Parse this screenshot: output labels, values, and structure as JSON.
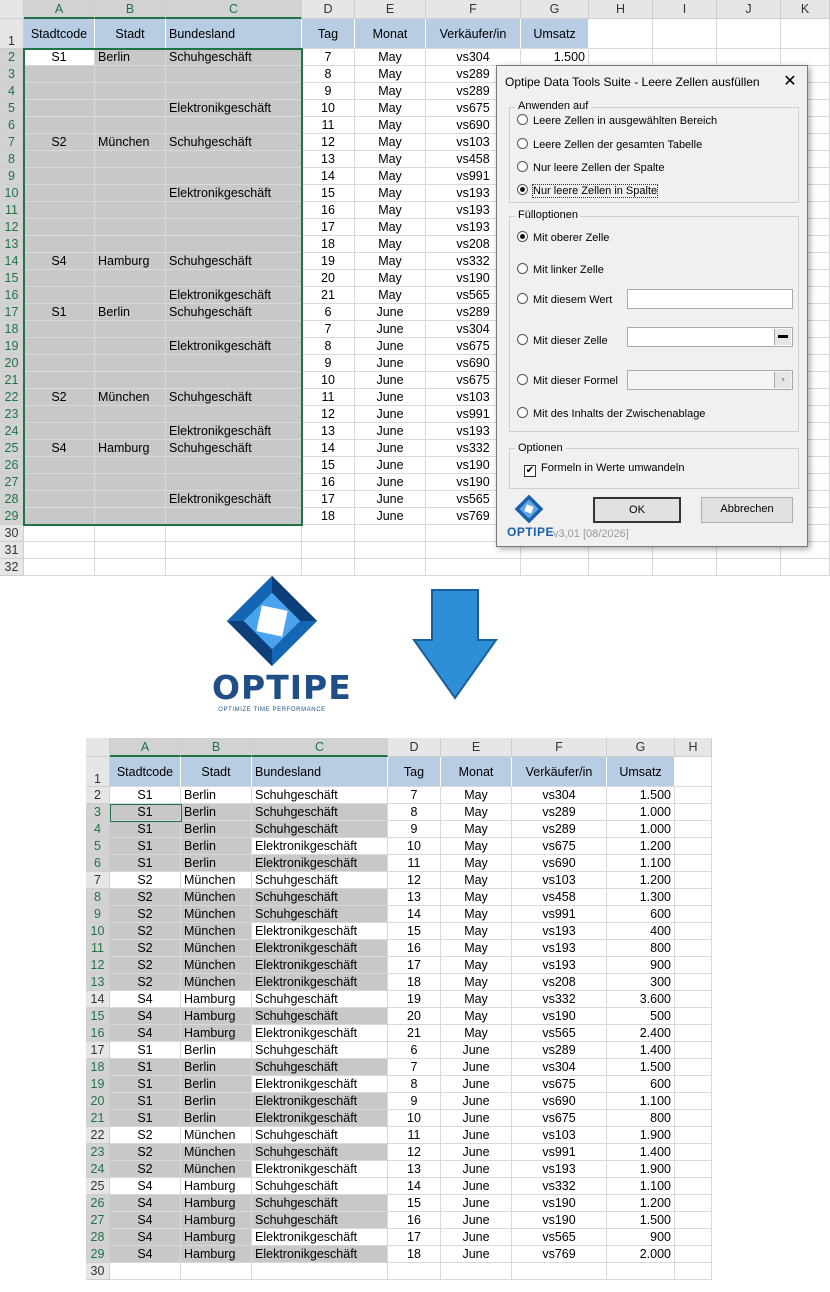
{
  "columns": [
    "A",
    "B",
    "C",
    "D",
    "E",
    "F",
    "G",
    "H",
    "I",
    "J",
    "K"
  ],
  "header_row": [
    "Stadtcode",
    "Stadt",
    "Bundesland",
    "Tag",
    "Monat",
    "Verkäufer/in",
    "Umsatz"
  ],
  "top_sheet": {
    "rows": [
      [
        "S1",
        "Berlin",
        "Schuhgeschäft",
        "7",
        "May",
        "vs304",
        "1.500"
      ],
      [
        "",
        "",
        "",
        "8",
        "May",
        "vs289",
        ""
      ],
      [
        "",
        "",
        "",
        "9",
        "May",
        "vs289",
        ""
      ],
      [
        "",
        "",
        "Elektronikgeschäft",
        "10",
        "May",
        "vs675",
        ""
      ],
      [
        "",
        "",
        "",
        "11",
        "May",
        "vs690",
        ""
      ],
      [
        "S2",
        "München",
        "Schuhgeschäft",
        "12",
        "May",
        "vs103",
        ""
      ],
      [
        "",
        "",
        "",
        "13",
        "May",
        "vs458",
        ""
      ],
      [
        "",
        "",
        "",
        "14",
        "May",
        "vs991",
        ""
      ],
      [
        "",
        "",
        "Elektronikgeschäft",
        "15",
        "May",
        "vs193",
        ""
      ],
      [
        "",
        "",
        "",
        "16",
        "May",
        "vs193",
        ""
      ],
      [
        "",
        "",
        "",
        "17",
        "May",
        "vs193",
        ""
      ],
      [
        "",
        "",
        "",
        "18",
        "May",
        "vs208",
        ""
      ],
      [
        "S4",
        "Hamburg",
        "Schuhgeschäft",
        "19",
        "May",
        "vs332",
        ""
      ],
      [
        "",
        "",
        "",
        "20",
        "May",
        "vs190",
        ""
      ],
      [
        "",
        "",
        "Elektronikgeschäft",
        "21",
        "May",
        "vs565",
        ""
      ],
      [
        "S1",
        "Berlin",
        "Schuhgeschäft",
        "6",
        "June",
        "vs289",
        ""
      ],
      [
        "",
        "",
        "",
        "7",
        "June",
        "vs304",
        ""
      ],
      [
        "",
        "",
        "Elektronikgeschäft",
        "8",
        "June",
        "vs675",
        ""
      ],
      [
        "",
        "",
        "",
        "9",
        "June",
        "vs690",
        ""
      ],
      [
        "",
        "",
        "",
        "10",
        "June",
        "vs675",
        ""
      ],
      [
        "S2",
        "München",
        "Schuhgeschäft",
        "11",
        "June",
        "vs103",
        ""
      ],
      [
        "",
        "",
        "",
        "12",
        "June",
        "vs991",
        ""
      ],
      [
        "",
        "",
        "Elektronikgeschäft",
        "13",
        "June",
        "vs193",
        ""
      ],
      [
        "S4",
        "Hamburg",
        "Schuhgeschäft",
        "14",
        "June",
        "vs332",
        ""
      ],
      [
        "",
        "",
        "",
        "15",
        "June",
        "vs190",
        ""
      ],
      [
        "",
        "",
        "",
        "16",
        "June",
        "vs190",
        ""
      ],
      [
        "",
        "",
        "Elektronikgeschäft",
        "17",
        "June",
        "vs565",
        ""
      ],
      [
        "",
        "",
        "",
        "18",
        "June",
        "vs769",
        ""
      ]
    ],
    "extra_row_numbers": [
      "30",
      "31",
      "32"
    ]
  },
  "dialog": {
    "title": "Optipe Data Tools Suite - Leere Zellen ausfüllen",
    "close": "✕",
    "group_apply": "Anwenden auf",
    "apply_options": [
      "Leere Zellen in ausgewählten Bereich",
      "Leere Zellen der gesamten Tabelle",
      "Nur leere Zellen der Spalte",
      "Nur leere Zellen in Spalte"
    ],
    "apply_selected": 3,
    "group_fill": "Fülloptionen",
    "fill_options": [
      "Mit oberer Zelle",
      "Mit linker Zelle",
      "Mit diesem Wert",
      "Mit dieser Zelle",
      "Mit dieser Formel",
      "Mit des Inhalts der Zwischenablage"
    ],
    "fill_selected": 0,
    "group_options": "Optionen",
    "checkbox_label": "Formeln in Werte umwandeln",
    "checkbox_checked": true,
    "ok": "OK",
    "cancel": "Abbrechen",
    "logo_text": "OPTIPE",
    "version": "v3,01 [08/2026]"
  },
  "logo": {
    "name": "OPTIPE",
    "tagline": "OPTIMIZE TIME PERFORMANCE"
  },
  "bottom_sheet": {
    "rows": [
      [
        "S1",
        "Berlin",
        "Schuhgeschäft",
        "7",
        "May",
        "vs304",
        "1.500"
      ],
      [
        "S1",
        "Berlin",
        "Schuhgeschäft",
        "8",
        "May",
        "vs289",
        "1.000"
      ],
      [
        "S1",
        "Berlin",
        "Schuhgeschäft",
        "9",
        "May",
        "vs289",
        "1.000"
      ],
      [
        "S1",
        "Berlin",
        "Elektronikgeschäft",
        "10",
        "May",
        "vs675",
        "1.200"
      ],
      [
        "S1",
        "Berlin",
        "Elektronikgeschäft",
        "11",
        "May",
        "vs690",
        "1.100"
      ],
      [
        "S2",
        "München",
        "Schuhgeschäft",
        "12",
        "May",
        "vs103",
        "1.200"
      ],
      [
        "S2",
        "München",
        "Schuhgeschäft",
        "13",
        "May",
        "vs458",
        "1.300"
      ],
      [
        "S2",
        "München",
        "Schuhgeschäft",
        "14",
        "May",
        "vs991",
        "600"
      ],
      [
        "S2",
        "München",
        "Elektronikgeschäft",
        "15",
        "May",
        "vs193",
        "400"
      ],
      [
        "S2",
        "München",
        "Elektronikgeschäft",
        "16",
        "May",
        "vs193",
        "800"
      ],
      [
        "S2",
        "München",
        "Elektronikgeschäft",
        "17",
        "May",
        "vs193",
        "900"
      ],
      [
        "S2",
        "München",
        "Elektronikgeschäft",
        "18",
        "May",
        "vs208",
        "300"
      ],
      [
        "S4",
        "Hamburg",
        "Schuhgeschäft",
        "19",
        "May",
        "vs332",
        "3.600"
      ],
      [
        "S4",
        "Hamburg",
        "Schuhgeschäft",
        "20",
        "May",
        "vs190",
        "500"
      ],
      [
        "S4",
        "Hamburg",
        "Elektronikgeschäft",
        "21",
        "May",
        "vs565",
        "2.400"
      ],
      [
        "S1",
        "Berlin",
        "Schuhgeschäft",
        "6",
        "June",
        "vs289",
        "1.400"
      ],
      [
        "S1",
        "Berlin",
        "Schuhgeschäft",
        "7",
        "June",
        "vs304",
        "1.500"
      ],
      [
        "S1",
        "Berlin",
        "Elektronikgeschäft",
        "8",
        "June",
        "vs675",
        "600"
      ],
      [
        "S1",
        "Berlin",
        "Elektronikgeschäft",
        "9",
        "June",
        "vs690",
        "1.100"
      ],
      [
        "S1",
        "Berlin",
        "Elektronikgeschäft",
        "10",
        "June",
        "vs675",
        "800"
      ],
      [
        "S2",
        "München",
        "Schuhgeschäft",
        "11",
        "June",
        "vs103",
        "1.900"
      ],
      [
        "S2",
        "München",
        "Schuhgeschäft",
        "12",
        "June",
        "vs991",
        "1.400"
      ],
      [
        "S2",
        "München",
        "Elektronikgeschäft",
        "13",
        "June",
        "vs193",
        "1.900"
      ],
      [
        "S4",
        "Hamburg",
        "Schuhgeschäft",
        "14",
        "June",
        "vs332",
        "1.100"
      ],
      [
        "S4",
        "Hamburg",
        "Schuhgeschäft",
        "15",
        "June",
        "vs190",
        "1.200"
      ],
      [
        "S4",
        "Hamburg",
        "Schuhgeschäft",
        "16",
        "June",
        "vs190",
        "1.500"
      ],
      [
        "S4",
        "Hamburg",
        "Elektronikgeschäft",
        "17",
        "June",
        "vs565",
        "900"
      ],
      [
        "S4",
        "Hamburg",
        "Elektronikgeschäft",
        "18",
        "June",
        "vs769",
        "2.000"
      ]
    ],
    "extra_row_numbers": [
      "30"
    ]
  },
  "colors": {
    "header_fill": "#b8cce4",
    "filled_gray": "#c8c8c8",
    "excel_green": "#217346",
    "arrow_blue": "#2e8fd6"
  }
}
